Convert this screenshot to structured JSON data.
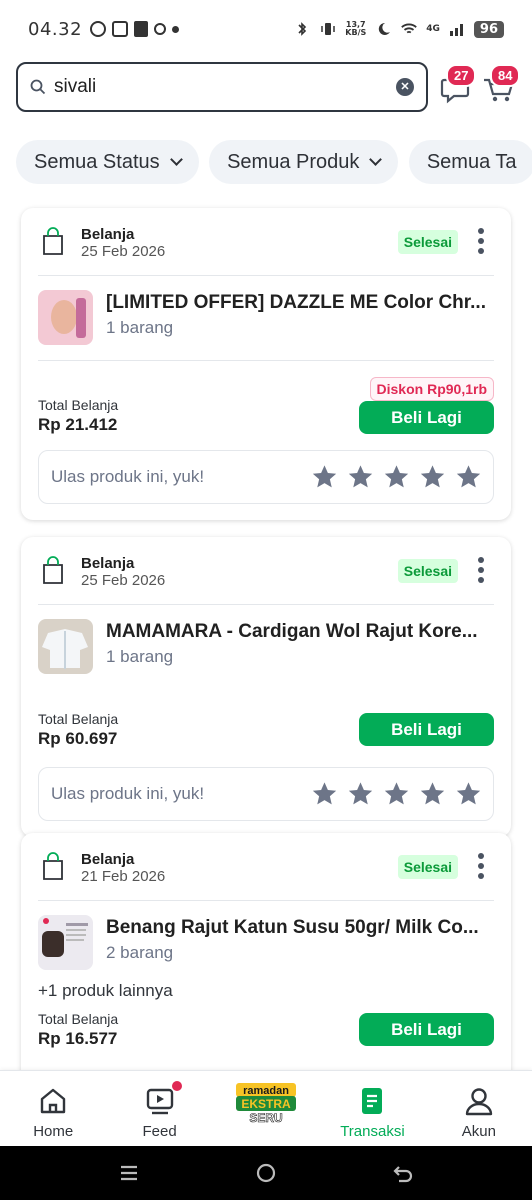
{
  "status_bar": {
    "time": "04.32",
    "net_speed_top": "13,7",
    "net_speed_bottom": "KB/S",
    "network": "4G",
    "battery": "96"
  },
  "search": {
    "query": "sivali",
    "chat_badge": "27",
    "cart_badge": "84"
  },
  "filters": [
    "Semua Status",
    "Semua Produk",
    "Semua Ta"
  ],
  "orders": [
    {
      "category": "Belanja",
      "date": "25 Feb 2026",
      "status": "Selesai",
      "product_name": "[LIMITED OFFER] DAZZLE ME Color Chr...",
      "quantity": "1 barang",
      "total_label": "Total Belanja",
      "total": "Rp 21.412",
      "discount": "Diskon Rp90,1rb",
      "buy_again": "Beli Lagi",
      "review_prompt": "Ulas produk ini, yuk!"
    },
    {
      "category": "Belanja",
      "date": "25 Feb 2026",
      "status": "Selesai",
      "product_name": "MAMAMARA - Cardigan Wol Rajut Kore...",
      "quantity": "1 barang",
      "total_label": "Total Belanja",
      "total": "Rp 60.697",
      "buy_again": "Beli Lagi",
      "review_prompt": "Ulas produk ini, yuk!"
    },
    {
      "category": "Belanja",
      "date": "21 Feb 2026",
      "status": "Selesai",
      "product_name": "Benang Rajut Katun Susu 50gr/ Milk Co...",
      "quantity": "2 barang",
      "more_products": "+1 produk lainnya",
      "total_label": "Total Belanja",
      "total": "Rp 16.577",
      "buy_again": "Beli Lagi"
    }
  ],
  "bottom_nav": {
    "home": "Home",
    "feed": "Feed",
    "promo_line1": "ramadan",
    "promo_line2": "EKSTRA",
    "promo_line3": "SERU",
    "transactions": "Transaksi",
    "account": "Akun"
  },
  "colors": {
    "accent_green": "#03ac57",
    "badge_red": "#e02954",
    "status_green_bg": "#d6ffde"
  }
}
